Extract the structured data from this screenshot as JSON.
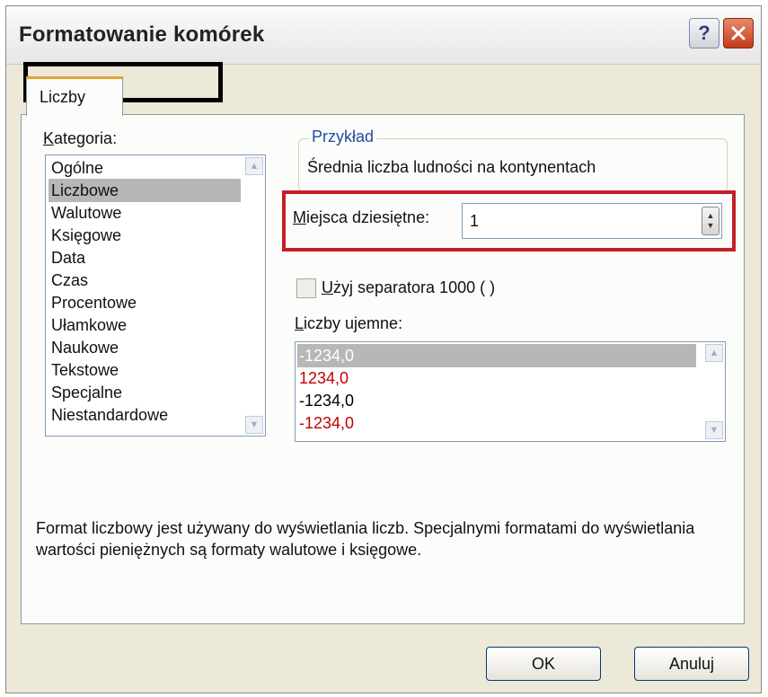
{
  "window": {
    "title": "Formatowanie komórek"
  },
  "titlebar": {
    "help_glyph": "?",
    "close_glyph": "✕"
  },
  "tab": {
    "label": "Liczby"
  },
  "category": {
    "label_key": "K",
    "label_rest": "ategoria:",
    "selected": "Liczbowe",
    "items": [
      "Ogólne",
      "Liczbowe",
      "Walutowe",
      "Księgowe",
      "Data",
      "Czas",
      "Procentowe",
      "Ułamkowe",
      "Naukowe",
      "Tekstowe",
      "Specjalne",
      "Niestandardowe"
    ]
  },
  "sample": {
    "legend": "Przykład",
    "value": "Średnia liczba ludności na kontynentach"
  },
  "decimal": {
    "label_key": "M",
    "label_rest": "iejsca dziesiętne:",
    "value": "1"
  },
  "separator": {
    "label_key": "U",
    "label_rest": "żyj separatora 1000 ( )",
    "checked": false
  },
  "negative": {
    "label_key": "L",
    "label_rest": "iczby ujemne:",
    "items": [
      {
        "text": "-1234,0",
        "color": "#ffffff",
        "selected": true
      },
      {
        "text": "1234,0",
        "color": "#c00000"
      },
      {
        "text": "-1234,0",
        "color": "#000000"
      },
      {
        "text": "-1234,0",
        "color": "#c00000"
      }
    ]
  },
  "description": "Format liczbowy jest używany do wyświetlania liczb. Specjalnymi formatami do wyświetlania wartości pieniężnych są formaty walutowe i księgowe.",
  "buttons": {
    "ok": "OK",
    "cancel": "Anuluj"
  },
  "colors": {
    "highlight_black": "#000000",
    "highlight_red": "#c41f28",
    "tab_accent": "#e4a33a"
  }
}
